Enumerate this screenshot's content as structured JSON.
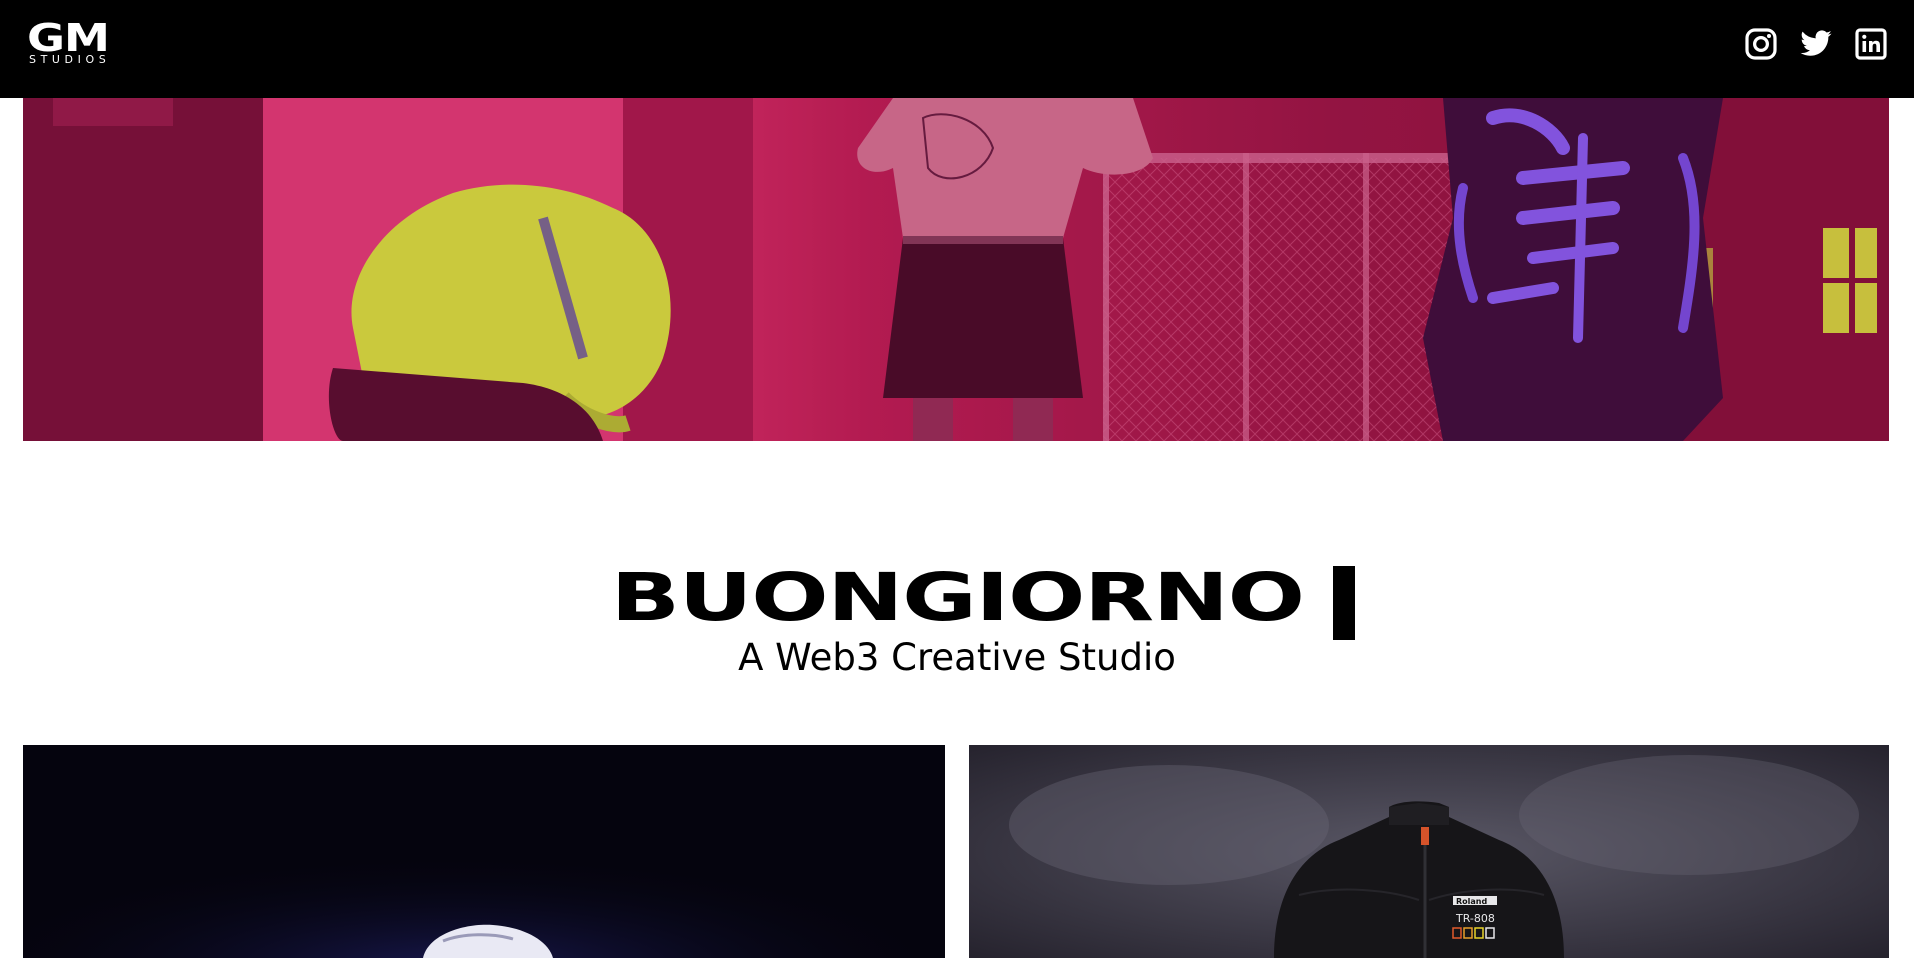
{
  "header": {
    "logo_main": "GM",
    "logo_sub": "STUDIOS",
    "social": [
      {
        "name": "instagram",
        "icon": "instagram-icon"
      },
      {
        "name": "twitter",
        "icon": "twitter-icon"
      },
      {
        "name": "linkedin",
        "icon": "linkedin-icon"
      }
    ]
  },
  "hero": {
    "tint_color": "#c21f5c"
  },
  "intro": {
    "headline": "BUONGIORNO",
    "tagline": "A Web3 Creative Studio"
  },
  "cards": [
    {
      "background": "#05040e"
    },
    {
      "background": "#2e2b36",
      "jacket_brand": "Roland",
      "jacket_model": "TR-808"
    }
  ]
}
